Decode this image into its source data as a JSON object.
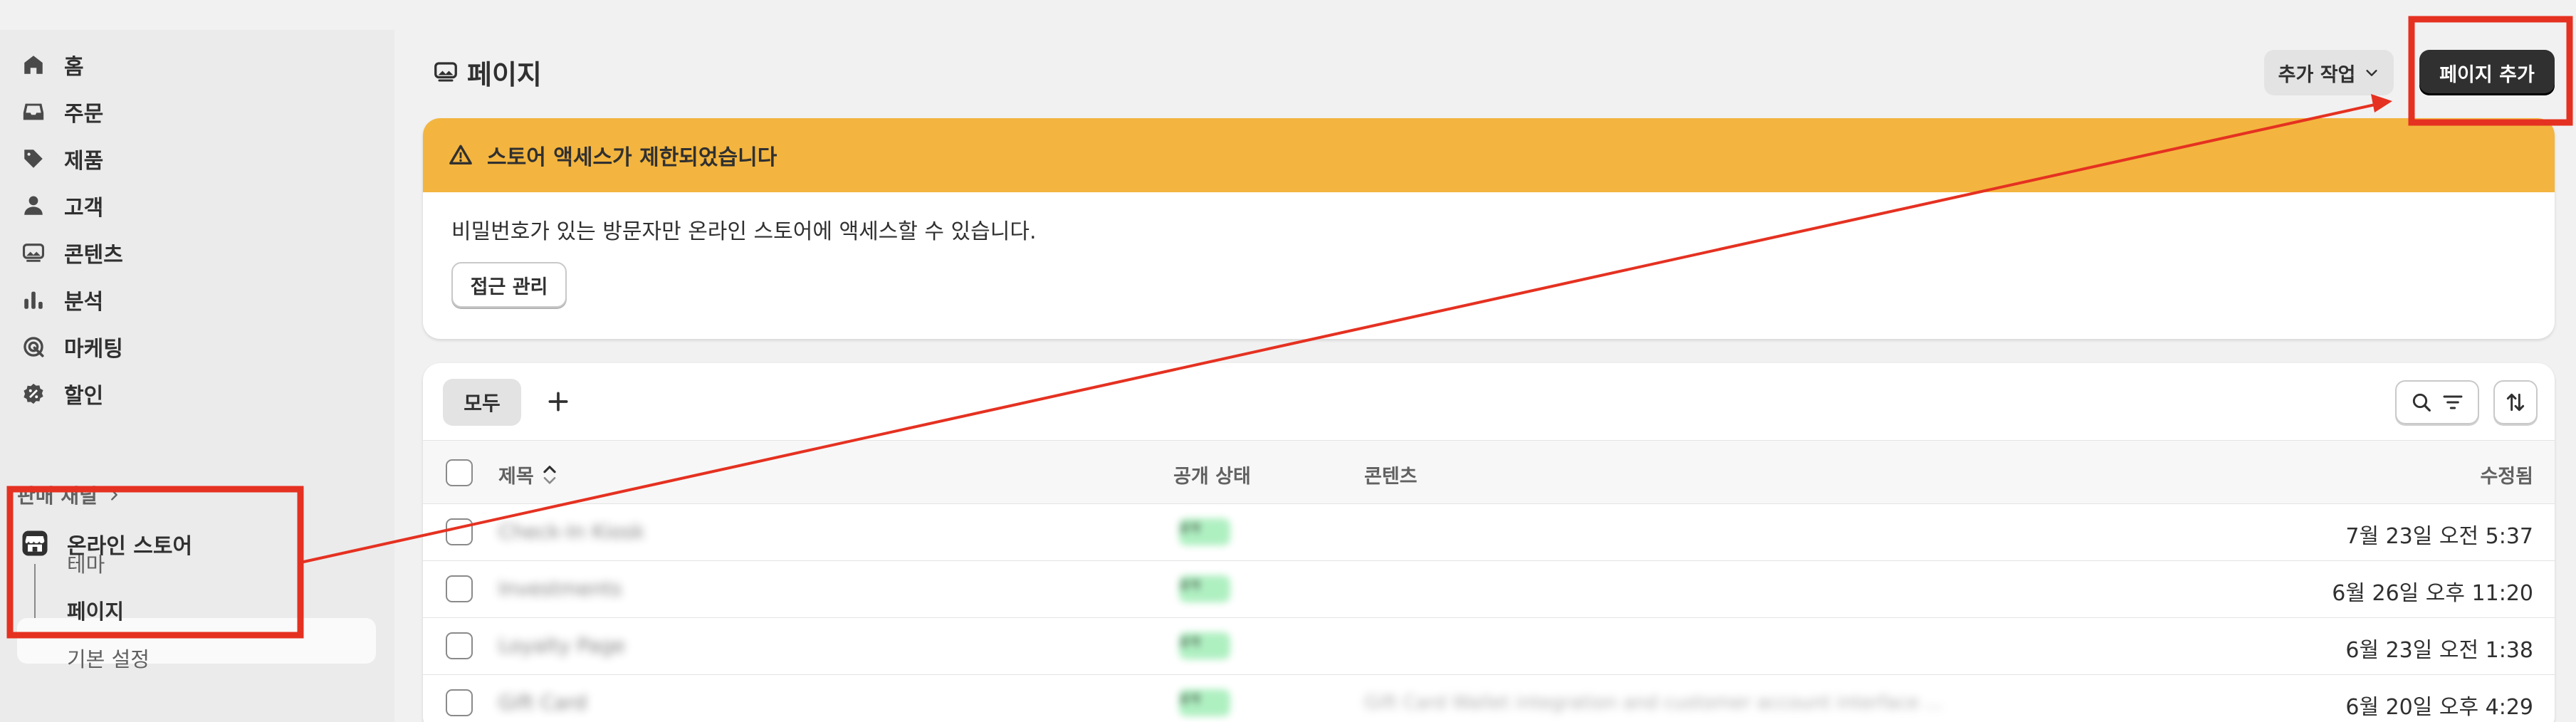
{
  "sidebar": {
    "items": [
      {
        "label": "홈",
        "icon": "home-icon"
      },
      {
        "label": "주문",
        "icon": "inbox-icon"
      },
      {
        "label": "제품",
        "icon": "tag-icon"
      },
      {
        "label": "고객",
        "icon": "person-icon"
      },
      {
        "label": "콘텐츠",
        "icon": "image-icon"
      },
      {
        "label": "분석",
        "icon": "bar-chart-icon"
      },
      {
        "label": "마케팅",
        "icon": "target-icon"
      },
      {
        "label": "할인",
        "icon": "discount-icon"
      }
    ],
    "channels_label": "판매 채널",
    "online_store": {
      "label": "온라인 스토어",
      "icon": "storefront-icon"
    },
    "sub_items": [
      "테마",
      "페이지"
    ],
    "settings_label": "기본 설정"
  },
  "header": {
    "title": "페이지",
    "more_actions_label": "추가 작업",
    "add_page_label": "페이지 추가"
  },
  "banner": {
    "title": "스토어 액세스가 제한되었습니다",
    "message": "비밀번호가 있는 방문자만 온라인 스토어에 액세스할 수 있습니다.",
    "button_label": "접근 관리"
  },
  "table": {
    "tabs": [
      "모두"
    ],
    "columns": {
      "title": "제목",
      "status": "공개 상태",
      "content": "콘텐츠",
      "updated": "수정됨"
    },
    "rows": [
      {
        "title": "Check-In Kiosk",
        "status": "공개",
        "content": "",
        "updated": "7월 23일 오전 5:37"
      },
      {
        "title": "Investments",
        "status": "공개",
        "content": "",
        "updated": "6월 26일 오후 11:20"
      },
      {
        "title": "Loyalty Page",
        "status": "공개",
        "content": "",
        "updated": "6월 23일 오전 1:38"
      },
      {
        "title": "Gift Card",
        "status": "공개",
        "content": "Gift Card Wallet integration and customer account interface ...",
        "updated": "6월 20일 오후 4:29"
      }
    ]
  },
  "colors": {
    "banner_warning": "#f3b53f",
    "primary_button": "#303030",
    "annotation_red": "#e53121",
    "status_green": "#aff0c1"
  }
}
